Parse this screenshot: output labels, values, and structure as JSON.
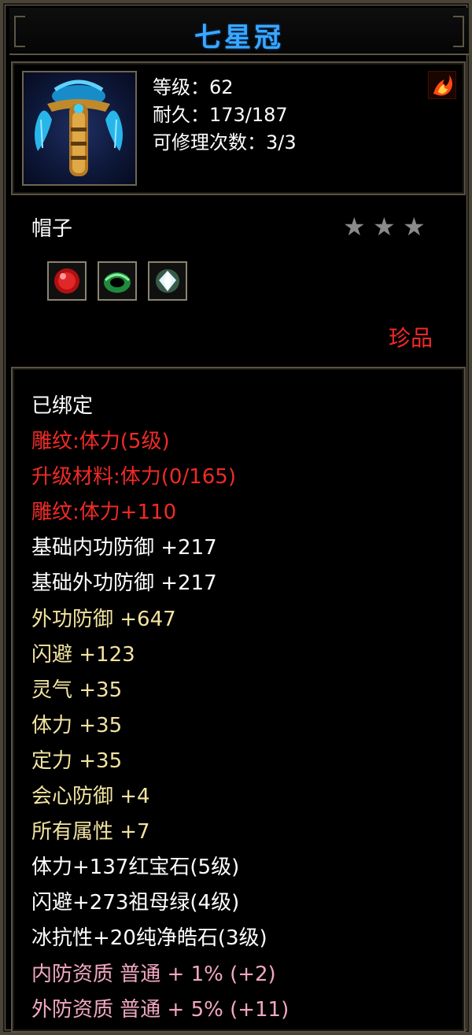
{
  "item": {
    "name": "七星冠",
    "level_text": "等级：62",
    "durability_text": "耐久：173/187",
    "repair_text": "可修理次数：3/3",
    "type": "帽子",
    "rarity": "珍品",
    "stars": {
      "filled": 0,
      "total": 3,
      "star_glyph": "★"
    },
    "icon": "crown-helmet-icon",
    "corner_icon": "fire-emblem-icon",
    "gems": [
      {
        "name": "ruby-gem-icon",
        "color": "#d81a1a"
      },
      {
        "name": "emerald-gem-icon",
        "color": "#2aa84a"
      },
      {
        "name": "diamond-gem-icon",
        "color": "#e8f4ff"
      }
    ]
  },
  "attributes": [
    {
      "text": "已绑定",
      "color": "white"
    },
    {
      "text": "雕纹:体力(5级)",
      "color": "red"
    },
    {
      "text": "升级材料:体力(0/165)",
      "color": "red"
    },
    {
      "text": "雕纹:体力+110",
      "color": "red"
    },
    {
      "text": "基础内功防御 +217",
      "color": "white"
    },
    {
      "text": "基础外功防御 +217",
      "color": "white"
    },
    {
      "text": "外功防御 +647",
      "color": "gold"
    },
    {
      "text": "闪避 +123",
      "color": "gold"
    },
    {
      "text": "灵气 +35",
      "color": "gold"
    },
    {
      "text": "体力 +35",
      "color": "gold"
    },
    {
      "text": "定力 +35",
      "color": "gold"
    },
    {
      "text": "会心防御 +4",
      "color": "gold"
    },
    {
      "text": "所有属性 +7",
      "color": "gold"
    },
    {
      "text": "体力+137红宝石(5级)",
      "color": "white"
    },
    {
      "text": "闪避+273祖母绿(4级)",
      "color": "white"
    },
    {
      "text": "冰抗性+20纯净皓石(3级)",
      "color": "white"
    },
    {
      "text": "内防资质 普通 + 1% (+2)",
      "color": "pink"
    },
    {
      "text": "外防资质 普通 + 5% (+11)",
      "color": "pink"
    }
  ],
  "colors": {
    "title": "#3aa8ff",
    "red": "#f12a26",
    "gold": "#f2e3a0",
    "pink": "#f2a8c2",
    "white": "#ffffff",
    "border": "#5a5244"
  }
}
